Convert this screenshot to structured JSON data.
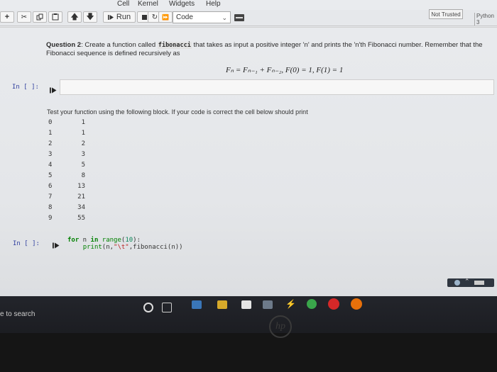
{
  "menu": {
    "items": [
      "Cell",
      "Kernel",
      "Widgets",
      "Help"
    ]
  },
  "toolbar": {
    "run_label": "Run",
    "cell_type": "Code",
    "trust_label": "Not Trusted",
    "kernel_name": "Python 3"
  },
  "cells": {
    "question": {
      "prefix": "Question 2",
      "text_before": ": Create a function called ",
      "code": "fibonacci",
      "text_after": " that takes as input a positive integer 'n' and prints the 'n'th Fibonacci number. Remember that the Fibonacci sequence is defined recursively as",
      "formula": "Fₙ = Fₙ₋₁ + Fₙ₋₂,  F(0) = 1, F(1) = 1"
    },
    "empty_cell": {
      "prompt": "In [ ]:"
    },
    "test_note": {
      "text": "Test your function using the following block. If your code is correct the cell below should print"
    },
    "table": {
      "n": [
        "0",
        "1",
        "2",
        "3",
        "4",
        "5",
        "6",
        "7",
        "8",
        "9"
      ],
      "fib": [
        "1",
        "1",
        "2",
        "3",
        "5",
        "8",
        "13",
        "21",
        "34",
        "55"
      ]
    },
    "code_cell": {
      "prompt": "In [ ]:",
      "lines": [
        "for n in range(10):",
        "    print(n,\"\\t\",fibonacci(n))"
      ]
    }
  },
  "taskbar": {
    "search_text": "e to search"
  },
  "colors": {
    "prompt": "#303f9f",
    "taskbar": "#1e2025",
    "accent_orange": "#e8700a"
  }
}
